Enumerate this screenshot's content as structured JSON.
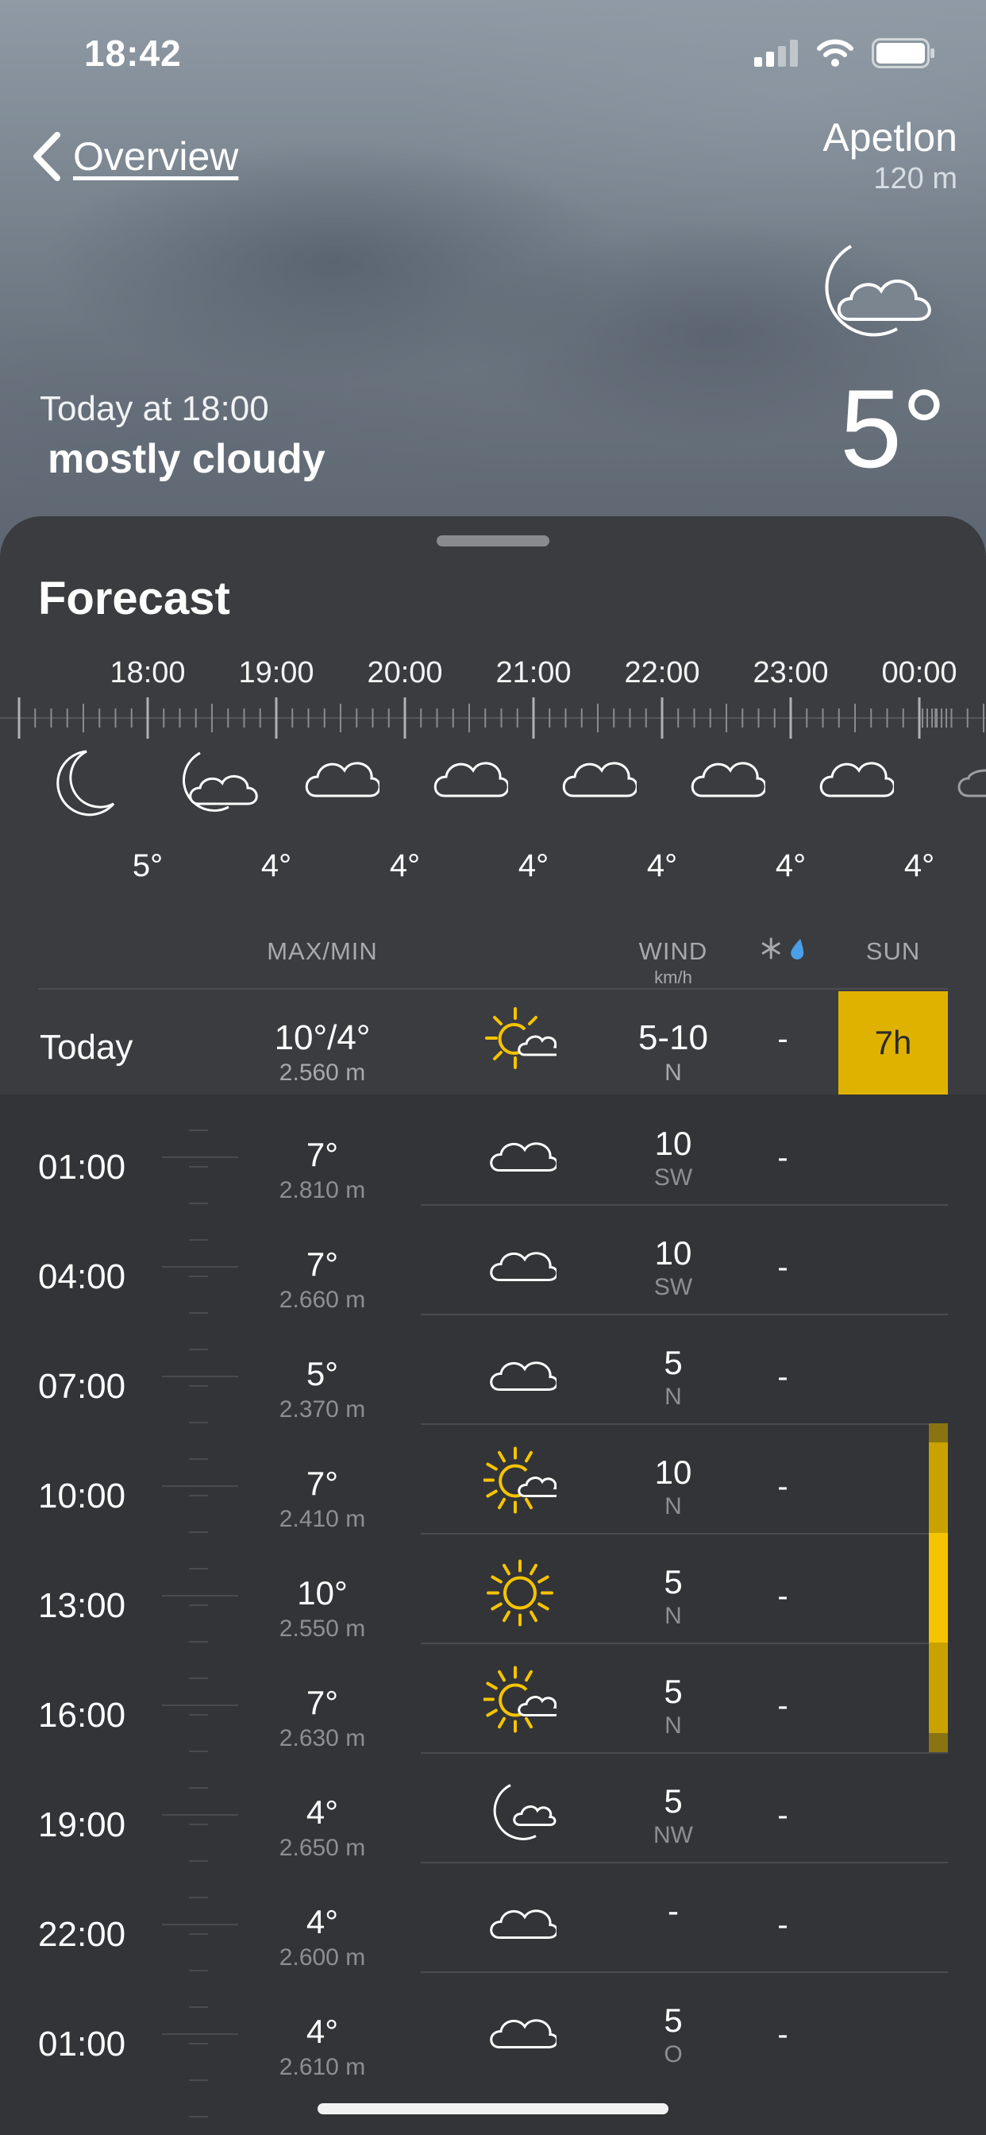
{
  "status": {
    "time": "18:42"
  },
  "header": {
    "back_label": "Overview",
    "location": "Apetlon",
    "altitude": "120 m",
    "current_when": "Today at 18:00",
    "current_desc": "mostly cloudy",
    "current_temp": "5°",
    "current_icon": "moon-cloud-icon"
  },
  "forecast": {
    "title": "Forecast",
    "hours": [
      "18:00",
      "19:00",
      "20:00",
      "21:00",
      "22:00",
      "23:00",
      "00:00"
    ],
    "hour_icons": [
      "moon-icon",
      "moon-cloud-icon",
      "cloud-icon",
      "cloud-icon",
      "cloud-icon",
      "cloud-icon",
      "cloud-icon",
      "cloud-icon"
    ],
    "hour_temps": [
      "5°",
      "4°",
      "4°",
      "4°",
      "4°",
      "4°",
      "4°"
    ]
  },
  "columns": {
    "maxmin": "MAX/MIN",
    "wind": "WIND",
    "wind_unit": "km/h",
    "sun": "SUN",
    "precip_icons": [
      "snowflake-icon",
      "raindrop-icon"
    ]
  },
  "today": {
    "label": "Today",
    "maxmin": "10°/4°",
    "snowline": "2.560 m",
    "icon": "sun-cloud-icon",
    "wind": "5-10",
    "wind_dir": "N",
    "precip": "-",
    "sun": "7h"
  },
  "detail_times": [
    "01:00",
    "04:00",
    "07:00",
    "10:00",
    "13:00",
    "16:00",
    "19:00",
    "22:00",
    "01:00"
  ],
  "detail_temps": [
    {
      "temp": "7°",
      "alt": "2.810 m"
    },
    {
      "temp": "7°",
      "alt": "2.660 m"
    },
    {
      "temp": "5°",
      "alt": "2.370 m"
    },
    {
      "temp": "7°",
      "alt": "2.410 m"
    },
    {
      "temp": "10°",
      "alt": "2.550 m"
    },
    {
      "temp": "7°",
      "alt": "2.630 m"
    },
    {
      "temp": "4°",
      "alt": "2.650 m"
    },
    {
      "temp": "4°",
      "alt": "2.600 m"
    },
    {
      "temp": "4°",
      "alt": "2.610 m"
    }
  ],
  "detail_rows": [
    {
      "icon": "cloud-icon",
      "wind": "10",
      "dir": "SW",
      "precip": "-"
    },
    {
      "icon": "cloud-icon",
      "wind": "10",
      "dir": "SW",
      "precip": "-"
    },
    {
      "icon": "cloud-icon",
      "wind": "5",
      "dir": "N",
      "precip": "-"
    },
    {
      "icon": "sun-cloud-icon",
      "wind": "10",
      "dir": "N",
      "precip": "-"
    },
    {
      "icon": "sun-icon",
      "wind": "5",
      "dir": "N",
      "precip": "-"
    },
    {
      "icon": "sun-cloud-icon",
      "wind": "5",
      "dir": "N",
      "precip": "-"
    },
    {
      "icon": "moon-cloud-icon",
      "wind": "5",
      "dir": "NW",
      "precip": "-"
    },
    {
      "icon": "cloud-icon",
      "wind": "-",
      "dir": "",
      "precip": "-"
    },
    {
      "icon": "cloud-icon",
      "wind": "5",
      "dir": "O",
      "precip": "-"
    }
  ],
  "colors": {
    "sun": "#e0b200",
    "sun_bright": "#f5c400",
    "sheet": "#3b3c40",
    "detail": "#333437"
  }
}
